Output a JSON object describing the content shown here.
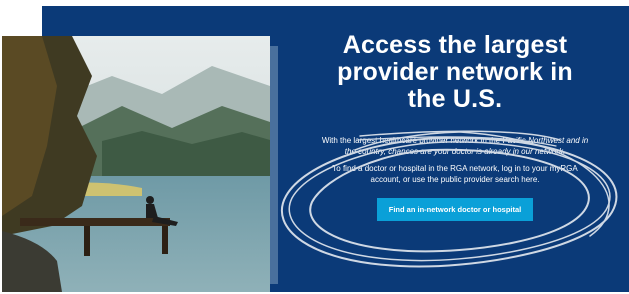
{
  "hero": {
    "headline": "Access the largest provider network in the U.S.",
    "paragraph_1_lead": "With the largest healthcare provider network in the Pacific",
    "paragraph_1_struck": "Northwest and in the country, chances are your doctor is already in our network.",
    "paragraph_2": "To find a doctor or hospital in the RGA network, log in to your myRGA account, or use the public provider search here.",
    "cta_label": "Find an in-network doctor or hospital"
  },
  "colors": {
    "panel_background": "#0b3a78",
    "cta_background": "#0aa0d8",
    "scribble": "#cfd8e4"
  }
}
